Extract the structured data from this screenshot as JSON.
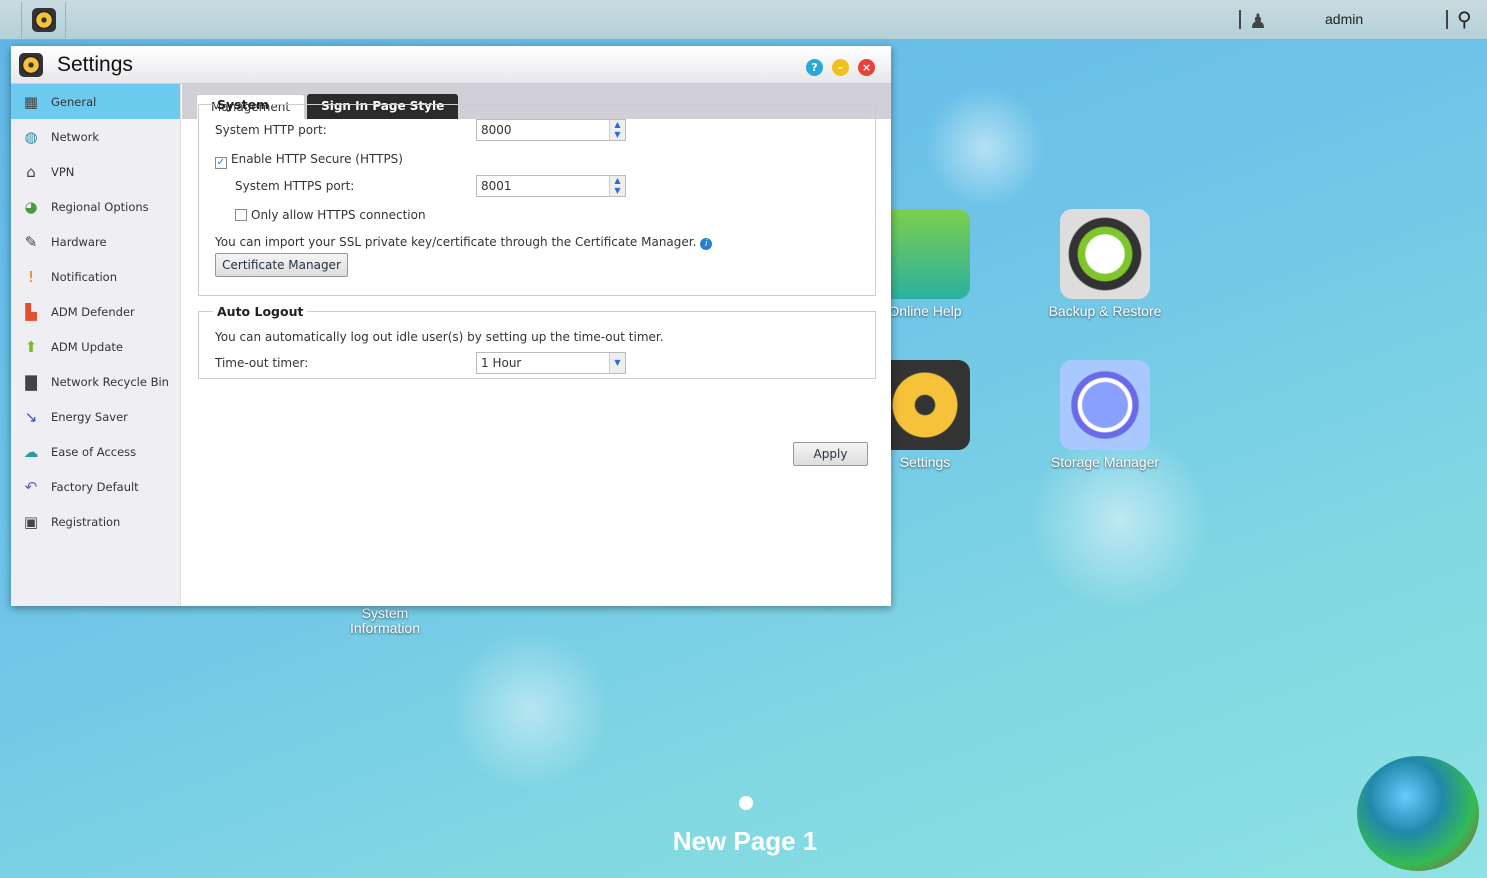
{
  "topbar": {
    "user": "admin"
  },
  "window": {
    "title": "Settings"
  },
  "sidebar": {
    "items": [
      {
        "label": "General",
        "icon": "nas-icon"
      },
      {
        "label": "Network",
        "icon": "globe-icon"
      },
      {
        "label": "VPN",
        "icon": "house-icon"
      },
      {
        "label": "Regional Options",
        "icon": "region-icon"
      },
      {
        "label": "Hardware",
        "icon": "wrench-icon"
      },
      {
        "label": "Notification",
        "icon": "alert-icon"
      },
      {
        "label": "ADM Defender",
        "icon": "firewall-icon"
      },
      {
        "label": "ADM Update",
        "icon": "arrow-up-icon"
      },
      {
        "label": "Network Recycle Bin",
        "icon": "trash-icon"
      },
      {
        "label": "Energy Saver",
        "icon": "energy-icon"
      },
      {
        "label": "Ease of Access",
        "icon": "cloud-icon"
      },
      {
        "label": "Factory Default",
        "icon": "undo-icon"
      },
      {
        "label": "Registration",
        "icon": "register-icon"
      }
    ]
  },
  "tabs": [
    "Management",
    "Sign In Page Style"
  ],
  "system": {
    "legend": "System",
    "http_label": "System HTTP port:",
    "http_value": "8000",
    "https_enable": "Enable HTTP Secure (HTTPS)",
    "https_label": "System HTTPS port:",
    "https_value": "8001",
    "only_https": "Only allow HTTPS connection",
    "ssl_text": "You can import your SSL private key/certificate through the Certificate Manager.",
    "cert_button": "Certificate Manager"
  },
  "auto_logout": {
    "legend": "Auto Logout",
    "desc": "You can automatically log out idle user(s) by setting up the time-out timer.",
    "timer_label": "Time-out timer:",
    "timer_value": "1 Hour"
  },
  "apply": "Apply",
  "desktop": {
    "icons": [
      "Online Help",
      "Backup & Restore",
      "Settings",
      "Storage Manager"
    ],
    "hidden_icon": "System Information",
    "page": "New Page 1",
    "logo": "KC"
  }
}
